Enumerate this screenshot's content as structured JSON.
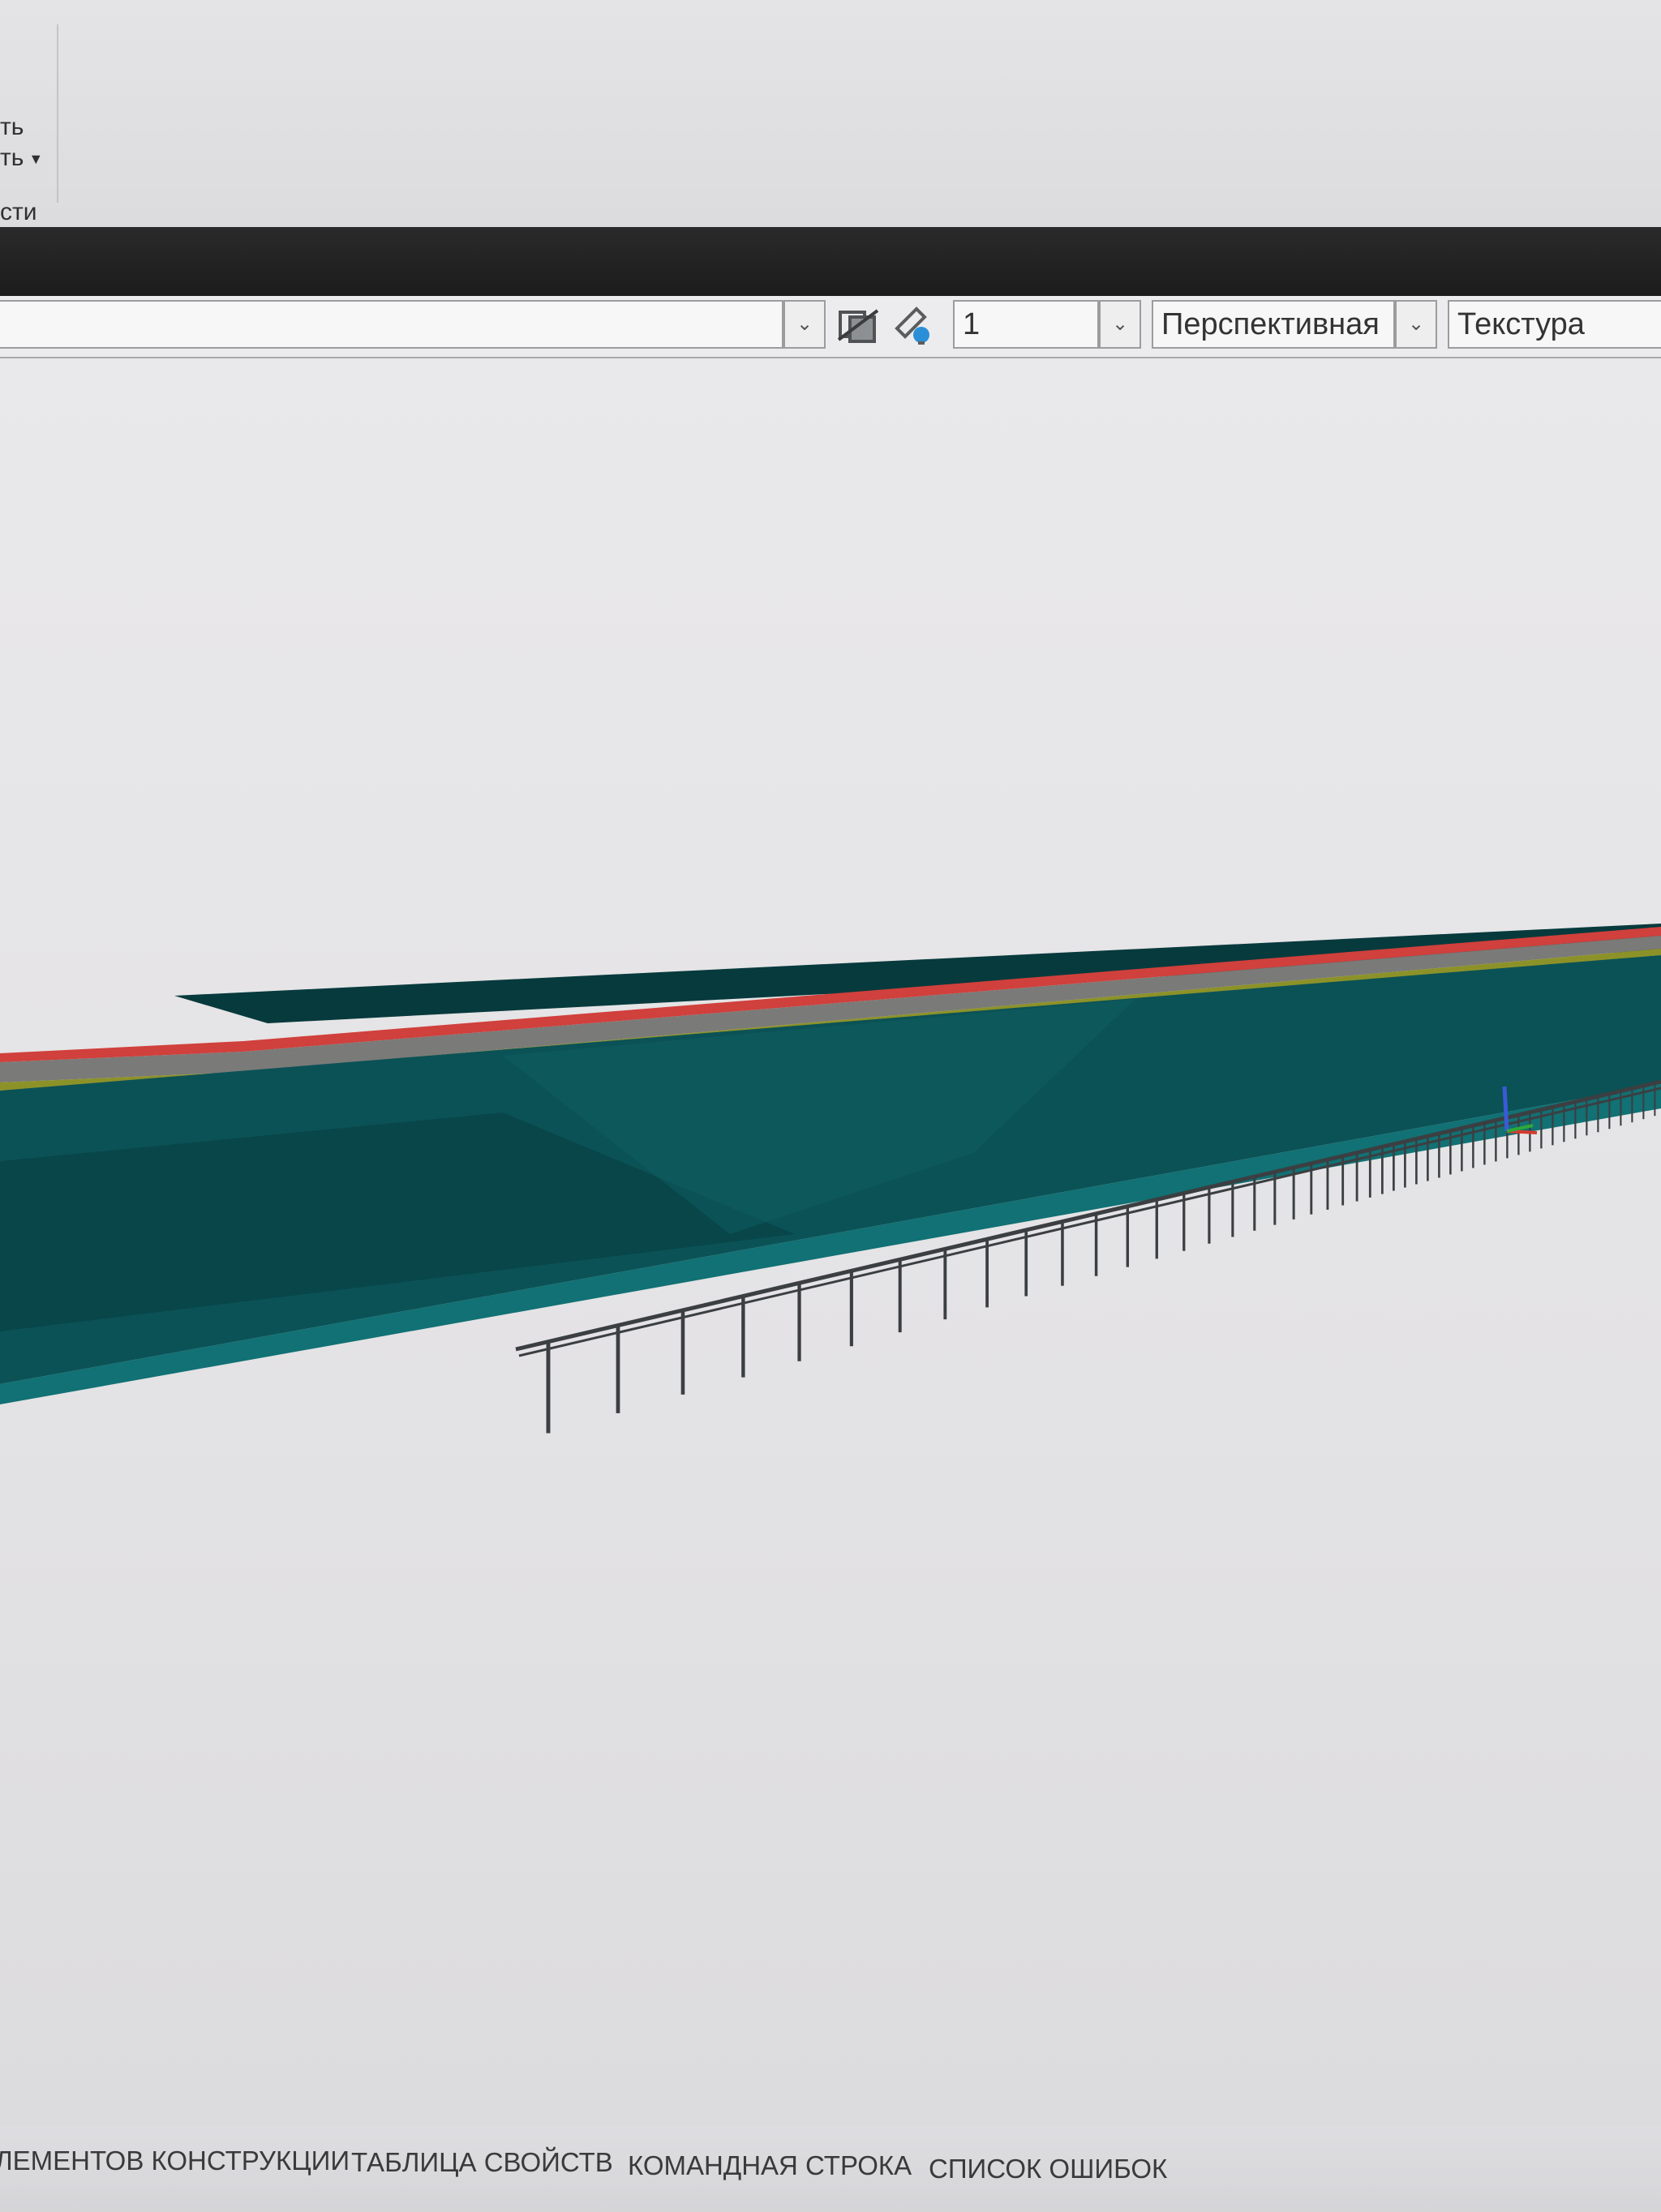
{
  "ribbon": {
    "items": [
      {
        "label": "ть"
      },
      {
        "label": "ть"
      },
      {
        "label": "сти"
      }
    ]
  },
  "viewbar": {
    "selector_1": {
      "value": ""
    },
    "layer_value": "1",
    "projection_value": "Перспективная",
    "display_style_value": "Текстура",
    "icons": [
      "visibility-icon",
      "light-icon"
    ]
  },
  "viewport": {
    "model": "bridge-deck-with-railing",
    "colors": {
      "deck_top": "#073a3d",
      "deck_face": "#0b5256",
      "deck_edge": "#117174",
      "red_line": "#d0403c",
      "road_gray": "#7a7a78",
      "yellow_line": "#8c9228",
      "railing": "#3b3f42",
      "axis_x": "#d63a30",
      "axis_y": "#2fa838",
      "axis_z": "#3a5ad8"
    }
  },
  "bottom_tabs": {
    "items": [
      {
        "label": "ЛЕМЕНТОВ КОНСТРУКЦИИ"
      },
      {
        "label": "ТАБЛИЦА СВОЙСТВ"
      },
      {
        "label": "КОМАНДНАЯ СТРОКА"
      },
      {
        "label": "СПИСОК ОШИБОК"
      }
    ]
  }
}
